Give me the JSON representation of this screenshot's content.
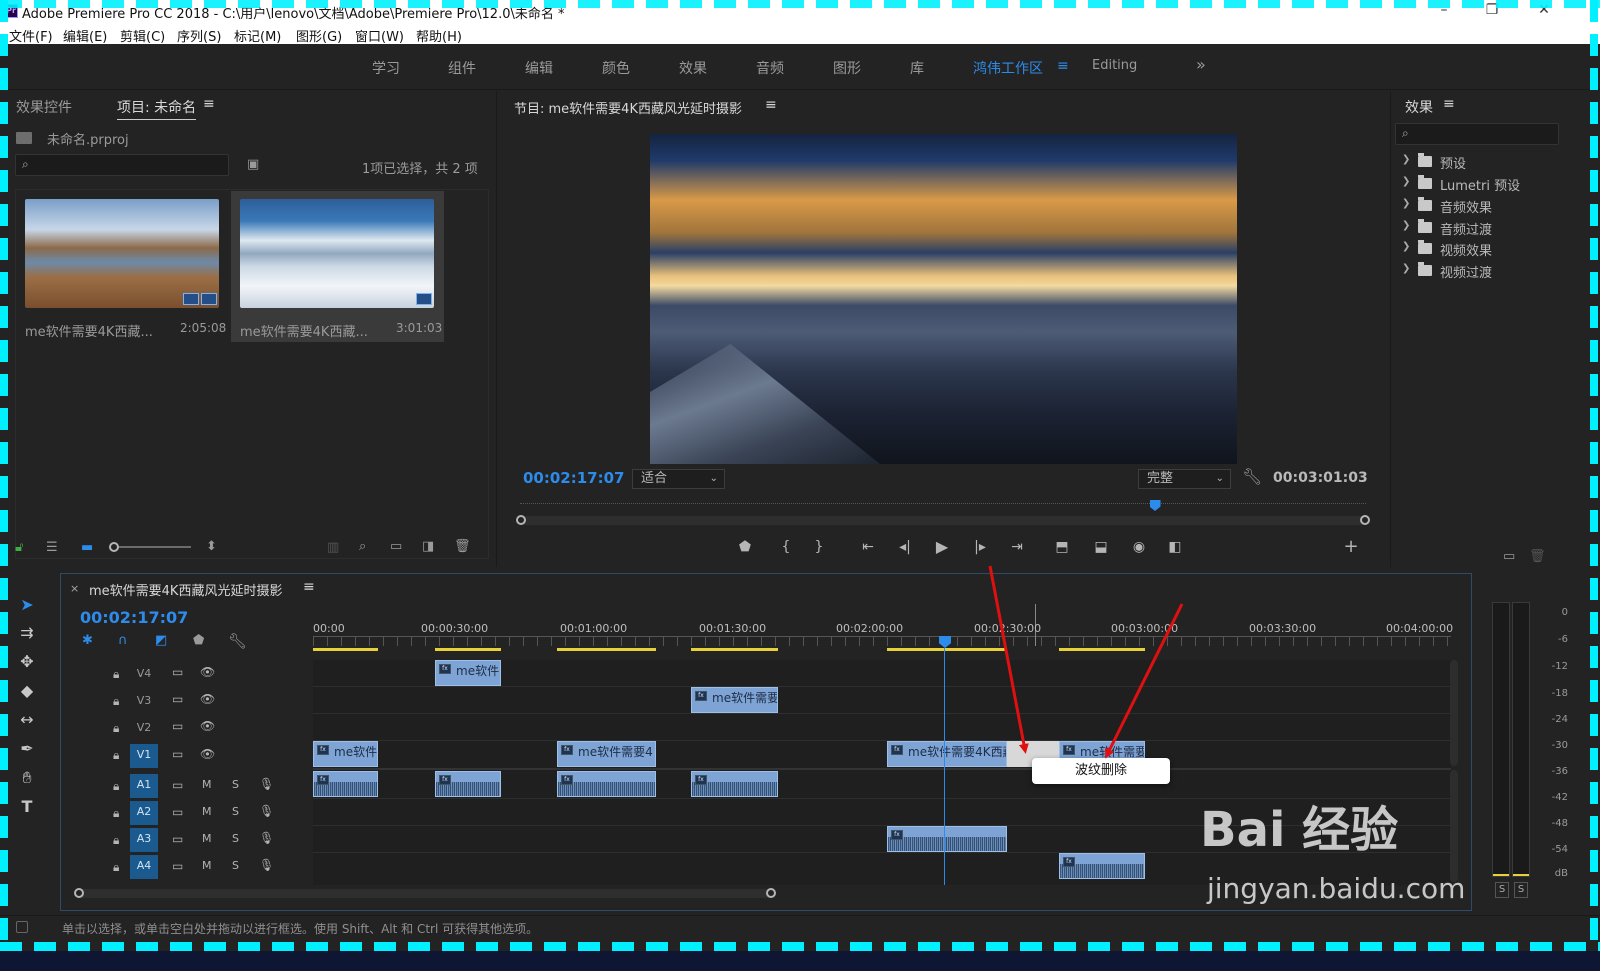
{
  "window": {
    "title": "Adobe Premiere Pro CC 2018 - C:\\用户\\lenovo\\文档\\Adobe\\Premiere Pro\\12.0\\未命名 *",
    "logo": "Pr"
  },
  "menu": [
    "文件(F)",
    "编辑(E)",
    "剪辑(C)",
    "序列(S)",
    "标记(M)",
    "图形(G)",
    "窗口(W)",
    "帮助(H)"
  ],
  "workspaces": {
    "items": [
      "学习",
      "组件",
      "编辑",
      "颜色",
      "效果",
      "音频",
      "图形",
      "库"
    ],
    "active": "鸿伟工作区",
    "editing": "Editing",
    "more": "»"
  },
  "project": {
    "tab_effect_controls": "效果控件",
    "tab_project": "项目: 未命名",
    "file": "未命名.prproj",
    "selection_info": "1项已选择，共 2 项",
    "clips": [
      {
        "name": "me软件需要4K西藏...",
        "duration": "2:05:08"
      },
      {
        "name": "me软件需要4K西藏...",
        "duration": "3:01:03"
      }
    ]
  },
  "program": {
    "title": "节目: me软件需要4K西藏风光延时摄影",
    "current_tc": "00:02:17:07",
    "fit": "适合",
    "quality": "完整",
    "duration_tc": "00:03:01:03",
    "playhead_fraction": 0.75
  },
  "effects": {
    "title": "效果",
    "items": [
      "预设",
      "Lumetri 预设",
      "音频效果",
      "音频过渡",
      "视频效果",
      "视频过渡"
    ]
  },
  "timeline": {
    "title": "me软件需要4K西藏风光延时摄影",
    "current_tc": "00:02:17:07",
    "ruler": [
      "00:00",
      "00:00:30:00",
      "00:01:00:00",
      "00:01:30:00",
      "00:02:00:00",
      "00:02:30:00",
      "00:03:00:00",
      "00:03:30:00",
      "00:04:00:00"
    ],
    "video_tracks": [
      "V4",
      "V3",
      "V2",
      "V1"
    ],
    "audio_tracks": [
      "A1",
      "A2",
      "A3",
      "A4"
    ],
    "clip_names": {
      "v4": "me软件",
      "v3": "me软件需要",
      "v1a": "me软件",
      "v1b": "me软件需要4",
      "v1c": "me软件需要4K西藏",
      "v1d": "me软件需要"
    },
    "context_menu": "波纹删除",
    "meter_labels": [
      "0",
      "-6",
      "-12",
      "-18",
      "-24",
      "-30",
      "-36",
      "-42",
      "-48",
      "-54",
      "dB"
    ],
    "solo": [
      "S",
      "S"
    ]
  },
  "status": {
    "hint": "单击以选择，或单击空白处并拖动以进行框选。使用 Shift、Alt 和 Ctrl 可获得其他选项。"
  },
  "watermark": {
    "brand": "Bai 经验",
    "url": "jingyan.baidu.com"
  },
  "colors": {
    "accent": "#2d8ceb",
    "clip": "#7ea4d6",
    "arrow": "#e01010",
    "border": "#00f0ff"
  }
}
